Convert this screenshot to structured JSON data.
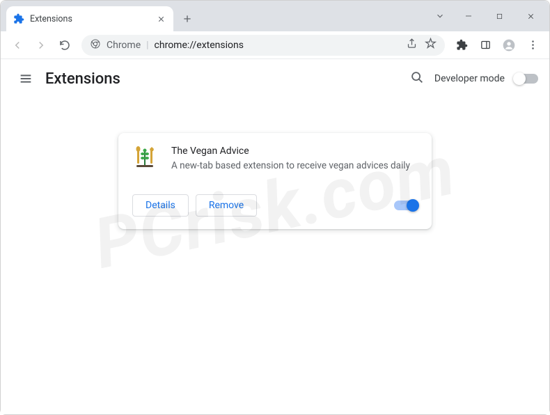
{
  "window": {
    "tab_title": "Extensions",
    "tab_dropdown": "⌄",
    "minimize": "—",
    "maximize": "☐",
    "close": "✕"
  },
  "toolbar": {
    "url_prefix": "Chrome",
    "url_path": "chrome://extensions"
  },
  "page": {
    "title": "Extensions",
    "developer_mode_label": "Developer mode",
    "developer_mode_on": false
  },
  "extension": {
    "name": "The Vegan Advice",
    "description": "A new-tab based extension to receive vegan advices daily",
    "details_label": "Details",
    "remove_label": "Remove",
    "enabled": true
  },
  "watermark": "PCrisk.com"
}
